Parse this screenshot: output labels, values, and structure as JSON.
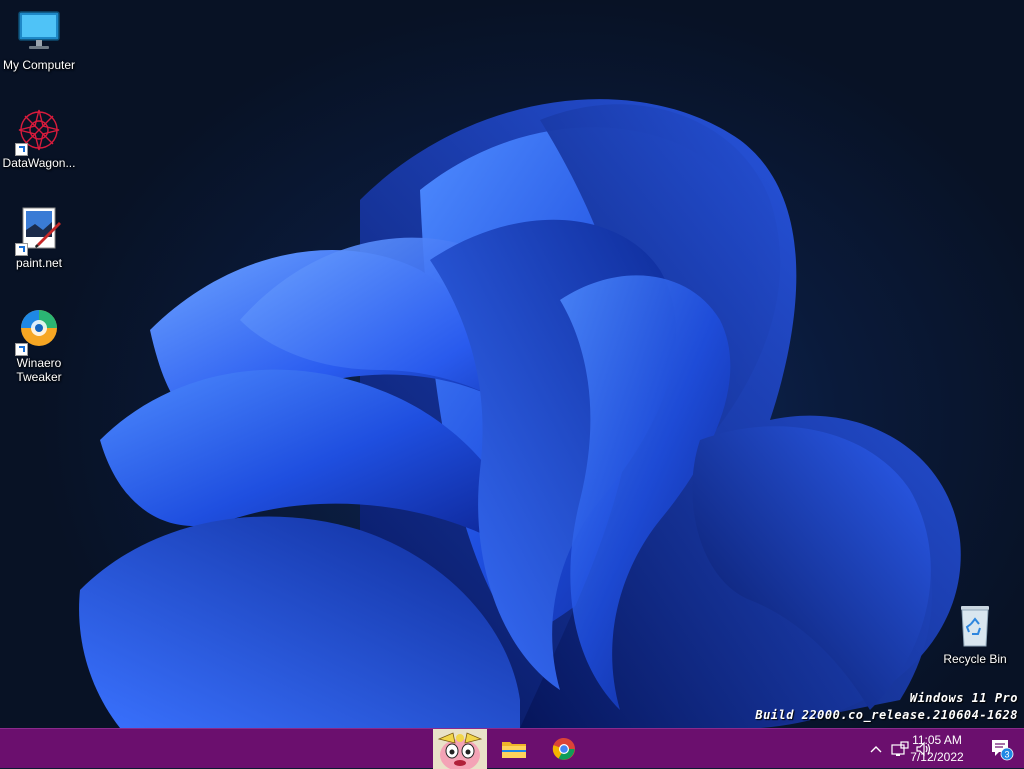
{
  "desktop": {
    "icons": [
      {
        "label": "My Computer",
        "icon": "monitor-icon"
      },
      {
        "label": "DataWagon...",
        "icon": "datawagon-icon"
      },
      {
        "label": "paint.net",
        "icon": "paintnet-icon"
      },
      {
        "label": "Winaero Tweaker",
        "icon": "winaero-icon"
      },
      {
        "label": "Recycle Bin",
        "icon": "recycle-bin-icon"
      }
    ]
  },
  "watermark": {
    "line1": "Windows 11 Pro",
    "line2": "Build 22000.co_release.210604-1628"
  },
  "taskbar": {
    "color": "#6b0f6e",
    "apps": [
      {
        "name": "start-avatar",
        "icon": "avatar-icon"
      },
      {
        "name": "file-explorer",
        "icon": "folder-icon"
      },
      {
        "name": "chrome",
        "icon": "chrome-icon"
      }
    ],
    "tray": {
      "chevron": "^",
      "time": "11:05 AM",
      "date": "7/12/2022",
      "notification_count": "3"
    }
  }
}
